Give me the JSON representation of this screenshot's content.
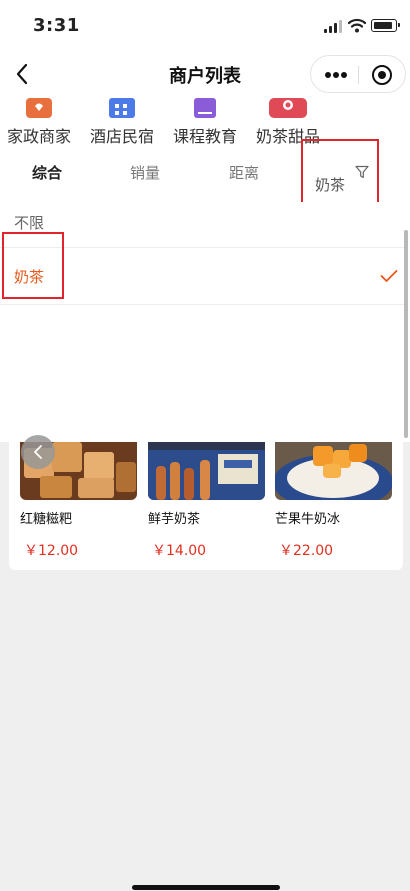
{
  "status_bar": {
    "time": "3:31"
  },
  "nav": {
    "title": "商户列表"
  },
  "categories": [
    {
      "label": "家政商家",
      "icon": "house-icon",
      "color": "#e8703e"
    },
    {
      "label": "酒店民宿",
      "icon": "hotel-icon",
      "color": "#4c7ae6"
    },
    {
      "label": "课程教育",
      "icon": "book-icon",
      "color": "#8a5cd8"
    },
    {
      "label": "奶茶甜品",
      "icon": "cup-icon",
      "color": "#e04a56"
    }
  ],
  "sort_tabs": {
    "overall": "综合",
    "sales": "销量",
    "distance": "距离",
    "filter": "奶茶"
  },
  "filter_options": {
    "all": "不限",
    "milk_tea": "奶茶"
  },
  "products": [
    {
      "name": "红糖糍粑",
      "price": "￥12.00"
    },
    {
      "name": "鲜芋奶茶",
      "price": "￥14.00"
    },
    {
      "name": "芒果牛奶冰",
      "price": "￥22.00"
    }
  ],
  "colors": {
    "accent": "#e8591a",
    "highlight_box": "#e0252b",
    "price": "#e0311f"
  }
}
